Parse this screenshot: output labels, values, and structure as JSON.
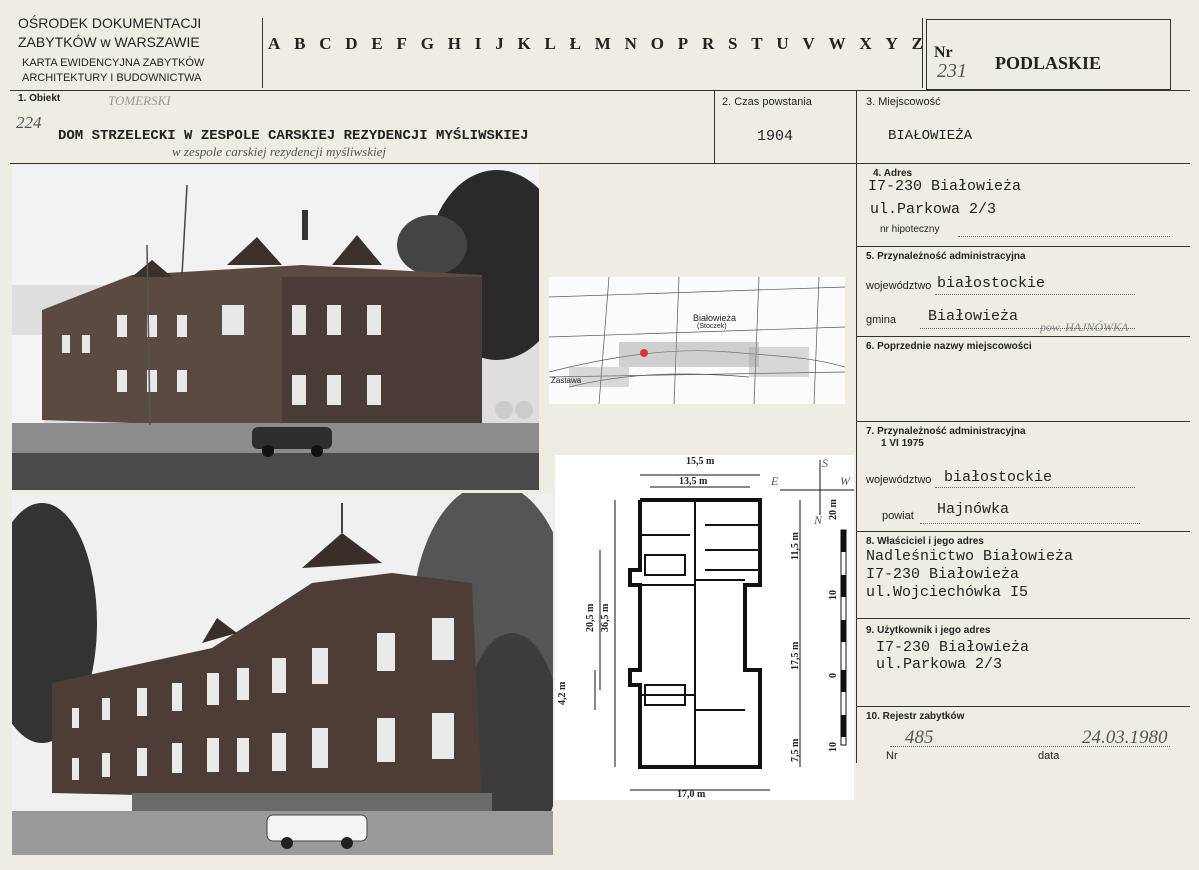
{
  "header": {
    "org_line1": "OŚRODEK DOKUMENTACJI",
    "org_line2": "ZABYTKÓW w WARSZAWIE",
    "card_line1": "KARTA EWIDENCYJNA ZABYTKÓW",
    "card_line2": "ARCHITEKTURY I BUDOWNICTWA",
    "alphabet": [
      "A",
      "B",
      "C",
      "D",
      "E",
      "F",
      "G",
      "H",
      "I",
      "J",
      "K",
      "L",
      "Ł",
      "M",
      "N",
      "O",
      "P",
      "R",
      "S",
      "T",
      "U",
      "V",
      "W",
      "X",
      "Y",
      "Z"
    ],
    "nr_label": "Nr",
    "nr_value": "231",
    "region": "PODLASKIE"
  },
  "obiekt": {
    "label": "1. Obiekt",
    "hand_top": "TOMERSKI",
    "hand_left": "224",
    "title": "DOM STRZELECKI W ZESPOLE CARSKIEJ REZYDENCJI MYŚLIWSKIEJ",
    "hand_note": "w zespole carskiej rezydencji myśliwskiej"
  },
  "czas": {
    "label": "2. Czas powstania",
    "value": "1904"
  },
  "miejscowosc": {
    "label": "3. Miejscowość",
    "value": "BIAŁOWIEŻA"
  },
  "adres": {
    "label": "4. Adres",
    "line1": "I7-230 Białowieża",
    "line2": "ul.Parkowa 2/3",
    "hipoteczny": "nr hipoteczny"
  },
  "admin5": {
    "label": "5. Przynależność administracyjna",
    "woj_label": "województwo",
    "woj_value": "białostockie",
    "gmina_label": "gmina",
    "gmina_value": "Białowieża",
    "hand_pow": "pow. HAJNÓWKA"
  },
  "poprzednie": {
    "label": "6. Poprzednie nazwy miejscowości"
  },
  "admin7": {
    "label": "7. Przynależność administracyjna",
    "date": "1 VI 1975",
    "woj_label": "województwo",
    "woj_value": "białostockie",
    "powiat_label": "powiat",
    "powiat_value": "Hajnówka"
  },
  "wlasciciel": {
    "label": "8. Właściciel i jego adres",
    "line1": "Nadleśnictwo Białowieża",
    "line2": "I7-230 Białowieża",
    "line3": "ul.Wojciechówka I5"
  },
  "uzytkownik": {
    "label": "9. Użytkownik i jego adres",
    "line1": "I7-230 Białowieża",
    "line2": "ul.Parkowa 2/3"
  },
  "rejestr": {
    "label": "10. Rejestr zabytków",
    "nr_label": "Nr",
    "nr_value": "485",
    "data_label": "data",
    "data_value": "24.03.1980"
  },
  "map": {
    "town": "Białowieża",
    "sub": "(Stoczek)",
    "left": "Zastawa"
  },
  "plan": {
    "dim_top1": "15,5 m",
    "dim_top2": "13,5 m",
    "dim_bottom": "17,0 m",
    "dim_left1": "20,5 m",
    "dim_left2": "36,5 m",
    "dim_left3": "4,2 m",
    "dim_right1": "11,5 m",
    "dim_right2": "17,5 m",
    "dim_right3": "7,5 m",
    "scale_top": "20 m",
    "scale_mid": "10",
    "scale_zero": "0",
    "scale_bottom": "10",
    "compass_s": "S",
    "compass_e": "E",
    "compass_w": "W",
    "compass_n": "N"
  }
}
